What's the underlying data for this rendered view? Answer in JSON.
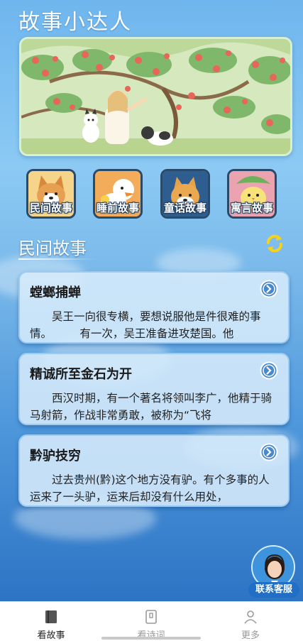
{
  "app": {
    "title": "故事小达人"
  },
  "categories": [
    {
      "label": "民间故事",
      "icon": "corgi-dog-icon",
      "color": "#f3c56a"
    },
    {
      "label": "睡前故事",
      "icon": "duck-icon",
      "color": "#f0a050"
    },
    {
      "label": "童话故事",
      "icon": "shiba-dog-icon",
      "color": "#2b5a8a"
    },
    {
      "label": "寓言故事",
      "icon": "chick-leaf-icon",
      "color": "#e89aa8"
    }
  ],
  "section": {
    "title": "民间故事",
    "refresh_icon": "refresh-icon"
  },
  "stories": [
    {
      "title": "螳螂捕蝉",
      "excerpt": "吴王一向很专横，要想说服他是件很难的事情。        有一次，吴王准备进攻楚国。他"
    },
    {
      "title": "精诚所至金石为开",
      "excerpt": "西汉时期，有一个著名将领叫李广，他精于骑马射箭，作战非常勇敢，被称为“飞将"
    },
    {
      "title": "黔驴技穷",
      "excerpt": "过去贵州(黔)这个地方没有驴。有个多事的人运来了一头驴，运来后却没有什么用处，"
    }
  ],
  "service": {
    "label": "联系客服"
  },
  "tabs": [
    {
      "label": "看故事",
      "icon": "book-icon",
      "active": true
    },
    {
      "label": "看诗词",
      "icon": "notebook-icon",
      "active": false
    },
    {
      "label": "更多",
      "icon": "person-icon",
      "active": false
    }
  ],
  "colors": {
    "accent": "#1f6fc7",
    "card_bg": "#d6eafa",
    "background_top": "#6fb6ee",
    "background_bottom": "#2d74c4"
  }
}
